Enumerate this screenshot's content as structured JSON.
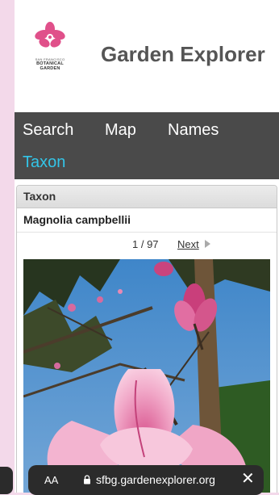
{
  "header": {
    "logo_line1": "SAN FRANCISCO",
    "logo_line2": "BOTANICAL",
    "logo_line3": "GARDEN",
    "title": "Garden Explorer"
  },
  "nav": {
    "items": [
      {
        "label": "Search"
      },
      {
        "label": "Map"
      },
      {
        "label": "Names"
      },
      {
        "label": "Taxon"
      }
    ],
    "active": "Taxon"
  },
  "taxon_panel": {
    "header": "Taxon",
    "name": "Magnolia campbellii",
    "position": "1 / 97",
    "next_label": "Next"
  },
  "browser": {
    "text_size_label": "AA",
    "url": "sfbg.gardenexplorer.org",
    "close_label": "✕"
  },
  "colors": {
    "nav_background": "#4a4a4a",
    "nav_active": "#33c5e8",
    "logo_pink": "#e0508a",
    "page_background": "#f3d9ea"
  }
}
